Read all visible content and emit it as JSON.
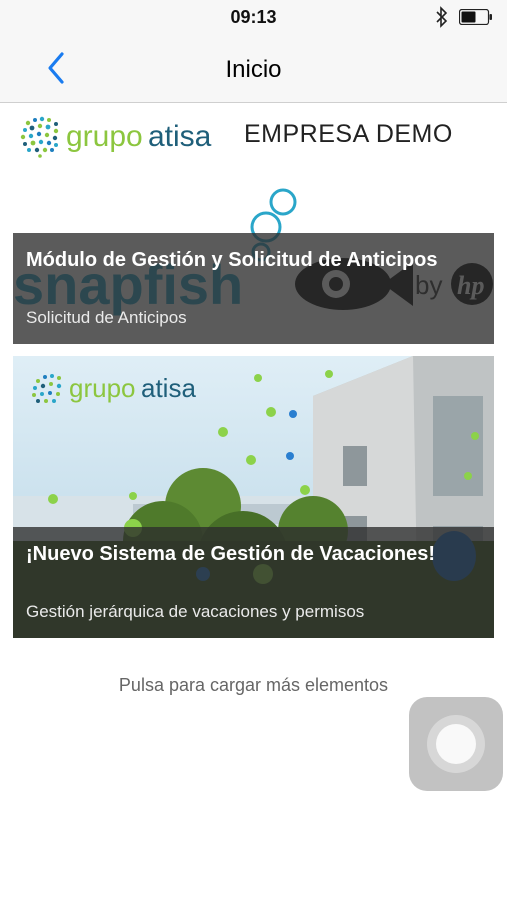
{
  "status_bar": {
    "time": "09:13",
    "bluetooth_icon": "bluetooth-icon",
    "battery_icon": "battery-icon"
  },
  "nav": {
    "title": "Inicio",
    "back_icon": "chevron-left-icon"
  },
  "brand": {
    "logo_prefix": "grupo",
    "logo_suffix": "atisa",
    "company": "EMPRESA DEMO"
  },
  "cards": [
    {
      "image_text": {
        "brand": "snapfish",
        "by": "by",
        "partner": "hp"
      },
      "title": "Módulo de Gestión y Solicitud de Anticipos",
      "subtitle": "Solicitud de Anticipos"
    },
    {
      "image_text": {
        "logo_prefix": "grupo",
        "logo_suffix": "atisa"
      },
      "title": "¡Nuevo Sistema de Gestión de Vacaciones!",
      "subtitle": "Gestión jerárquica de vacaciones y permisos"
    }
  ],
  "load_more": "Pulsa para cargar más elementos",
  "colors": {
    "nav_bg": "#f7f7f7",
    "accent_blue": "#1a7cf0",
    "logo_green": "#8cc63f",
    "logo_teal": "#1f5f7a"
  }
}
